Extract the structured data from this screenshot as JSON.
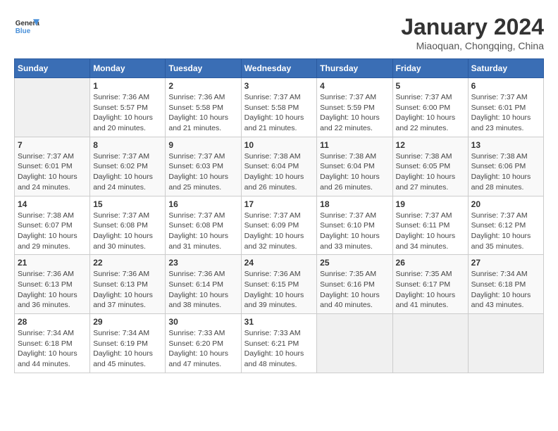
{
  "header": {
    "logo_general": "General",
    "logo_blue": "Blue",
    "title": "January 2024",
    "subtitle": "Miaoquan, Chongqing, China"
  },
  "weekdays": [
    "Sunday",
    "Monday",
    "Tuesday",
    "Wednesday",
    "Thursday",
    "Friday",
    "Saturday"
  ],
  "weeks": [
    [
      {
        "day": "",
        "sunrise": "",
        "sunset": "",
        "daylight": "",
        "empty": true
      },
      {
        "day": "1",
        "sunrise": "Sunrise: 7:36 AM",
        "sunset": "Sunset: 5:57 PM",
        "daylight": "Daylight: 10 hours and 20 minutes."
      },
      {
        "day": "2",
        "sunrise": "Sunrise: 7:36 AM",
        "sunset": "Sunset: 5:58 PM",
        "daylight": "Daylight: 10 hours and 21 minutes."
      },
      {
        "day": "3",
        "sunrise": "Sunrise: 7:37 AM",
        "sunset": "Sunset: 5:58 PM",
        "daylight": "Daylight: 10 hours and 21 minutes."
      },
      {
        "day": "4",
        "sunrise": "Sunrise: 7:37 AM",
        "sunset": "Sunset: 5:59 PM",
        "daylight": "Daylight: 10 hours and 22 minutes."
      },
      {
        "day": "5",
        "sunrise": "Sunrise: 7:37 AM",
        "sunset": "Sunset: 6:00 PM",
        "daylight": "Daylight: 10 hours and 22 minutes."
      },
      {
        "day": "6",
        "sunrise": "Sunrise: 7:37 AM",
        "sunset": "Sunset: 6:01 PM",
        "daylight": "Daylight: 10 hours and 23 minutes."
      }
    ],
    [
      {
        "day": "7",
        "sunrise": "Sunrise: 7:37 AM",
        "sunset": "Sunset: 6:01 PM",
        "daylight": "Daylight: 10 hours and 24 minutes."
      },
      {
        "day": "8",
        "sunrise": "Sunrise: 7:37 AM",
        "sunset": "Sunset: 6:02 PM",
        "daylight": "Daylight: 10 hours and 24 minutes."
      },
      {
        "day": "9",
        "sunrise": "Sunrise: 7:37 AM",
        "sunset": "Sunset: 6:03 PM",
        "daylight": "Daylight: 10 hours and 25 minutes."
      },
      {
        "day": "10",
        "sunrise": "Sunrise: 7:38 AM",
        "sunset": "Sunset: 6:04 PM",
        "daylight": "Daylight: 10 hours and 26 minutes."
      },
      {
        "day": "11",
        "sunrise": "Sunrise: 7:38 AM",
        "sunset": "Sunset: 6:04 PM",
        "daylight": "Daylight: 10 hours and 26 minutes."
      },
      {
        "day": "12",
        "sunrise": "Sunrise: 7:38 AM",
        "sunset": "Sunset: 6:05 PM",
        "daylight": "Daylight: 10 hours and 27 minutes."
      },
      {
        "day": "13",
        "sunrise": "Sunrise: 7:38 AM",
        "sunset": "Sunset: 6:06 PM",
        "daylight": "Daylight: 10 hours and 28 minutes."
      }
    ],
    [
      {
        "day": "14",
        "sunrise": "Sunrise: 7:38 AM",
        "sunset": "Sunset: 6:07 PM",
        "daylight": "Daylight: 10 hours and 29 minutes."
      },
      {
        "day": "15",
        "sunrise": "Sunrise: 7:37 AM",
        "sunset": "Sunset: 6:08 PM",
        "daylight": "Daylight: 10 hours and 30 minutes."
      },
      {
        "day": "16",
        "sunrise": "Sunrise: 7:37 AM",
        "sunset": "Sunset: 6:08 PM",
        "daylight": "Daylight: 10 hours and 31 minutes."
      },
      {
        "day": "17",
        "sunrise": "Sunrise: 7:37 AM",
        "sunset": "Sunset: 6:09 PM",
        "daylight": "Daylight: 10 hours and 32 minutes."
      },
      {
        "day": "18",
        "sunrise": "Sunrise: 7:37 AM",
        "sunset": "Sunset: 6:10 PM",
        "daylight": "Daylight: 10 hours and 33 minutes."
      },
      {
        "day": "19",
        "sunrise": "Sunrise: 7:37 AM",
        "sunset": "Sunset: 6:11 PM",
        "daylight": "Daylight: 10 hours and 34 minutes."
      },
      {
        "day": "20",
        "sunrise": "Sunrise: 7:37 AM",
        "sunset": "Sunset: 6:12 PM",
        "daylight": "Daylight: 10 hours and 35 minutes."
      }
    ],
    [
      {
        "day": "21",
        "sunrise": "Sunrise: 7:36 AM",
        "sunset": "Sunset: 6:13 PM",
        "daylight": "Daylight: 10 hours and 36 minutes."
      },
      {
        "day": "22",
        "sunrise": "Sunrise: 7:36 AM",
        "sunset": "Sunset: 6:13 PM",
        "daylight": "Daylight: 10 hours and 37 minutes."
      },
      {
        "day": "23",
        "sunrise": "Sunrise: 7:36 AM",
        "sunset": "Sunset: 6:14 PM",
        "daylight": "Daylight: 10 hours and 38 minutes."
      },
      {
        "day": "24",
        "sunrise": "Sunrise: 7:36 AM",
        "sunset": "Sunset: 6:15 PM",
        "daylight": "Daylight: 10 hours and 39 minutes."
      },
      {
        "day": "25",
        "sunrise": "Sunrise: 7:35 AM",
        "sunset": "Sunset: 6:16 PM",
        "daylight": "Daylight: 10 hours and 40 minutes."
      },
      {
        "day": "26",
        "sunrise": "Sunrise: 7:35 AM",
        "sunset": "Sunset: 6:17 PM",
        "daylight": "Daylight: 10 hours and 41 minutes."
      },
      {
        "day": "27",
        "sunrise": "Sunrise: 7:34 AM",
        "sunset": "Sunset: 6:18 PM",
        "daylight": "Daylight: 10 hours and 43 minutes."
      }
    ],
    [
      {
        "day": "28",
        "sunrise": "Sunrise: 7:34 AM",
        "sunset": "Sunset: 6:18 PM",
        "daylight": "Daylight: 10 hours and 44 minutes."
      },
      {
        "day": "29",
        "sunrise": "Sunrise: 7:34 AM",
        "sunset": "Sunset: 6:19 PM",
        "daylight": "Daylight: 10 hours and 45 minutes."
      },
      {
        "day": "30",
        "sunrise": "Sunrise: 7:33 AM",
        "sunset": "Sunset: 6:20 PM",
        "daylight": "Daylight: 10 hours and 47 minutes."
      },
      {
        "day": "31",
        "sunrise": "Sunrise: 7:33 AM",
        "sunset": "Sunset: 6:21 PM",
        "daylight": "Daylight: 10 hours and 48 minutes."
      },
      {
        "day": "",
        "sunrise": "",
        "sunset": "",
        "daylight": "",
        "empty": true
      },
      {
        "day": "",
        "sunrise": "",
        "sunset": "",
        "daylight": "",
        "empty": true
      },
      {
        "day": "",
        "sunrise": "",
        "sunset": "",
        "daylight": "",
        "empty": true
      }
    ]
  ]
}
